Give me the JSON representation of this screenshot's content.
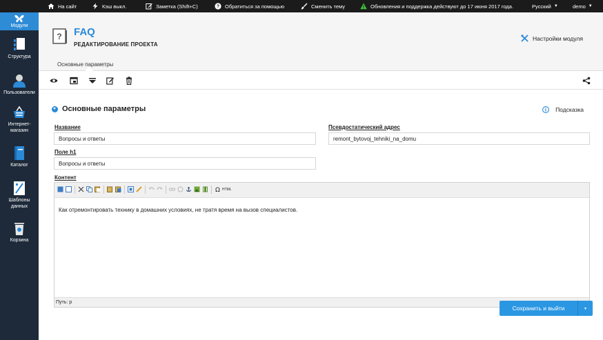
{
  "topbar": {
    "site": "На сайт",
    "cache": "Кэш выкл.",
    "note": "Заметка (Shift+C)",
    "help": "Обратиться за помощью",
    "theme": "Сменить тему",
    "updates": "Обновления и поддержка действуют до 17 июня 2017 года.",
    "language": "Русский",
    "user": "demo"
  },
  "sidebar": {
    "items": [
      {
        "label": "Модули"
      },
      {
        "label": "Структура"
      },
      {
        "label": "Пользователи"
      },
      {
        "label": "Интернет-\nмагазин"
      },
      {
        "label": "Каталог"
      },
      {
        "label": "Шаблоны\nданных"
      },
      {
        "label": "Корзина"
      }
    ]
  },
  "header": {
    "title": "FAQ",
    "subtitle": "РЕДАКТИРОВАНИЕ ПРОЕКТА",
    "module_settings": "Настройки модуля"
  },
  "tabs": {
    "main": "Основные параметры"
  },
  "section": {
    "title": "Основные параметры",
    "hint": "Подсказка"
  },
  "fields": {
    "name_label": "Название",
    "name_value": "Вопросы и ответы",
    "h1_label": "Поле h1",
    "h1_value": "Вопросы и ответы",
    "alias_label": "Псевдостатический адрес",
    "alias_value": "remont_bytovoj_tehniki_na_domu",
    "content_label": "Контент",
    "content_text": "Как отремонтировать технику в домашних условиях, не тратя время на вызов специалистов.",
    "editor_path": "Путь: p",
    "html_label": "HTML"
  },
  "actions": {
    "save": "Сохранить и выйти",
    "split_caret": "▾"
  },
  "colors": {
    "accent": "#2b8ad8",
    "sidebar": "#1e2a3a",
    "topbar": "#1b1b1b",
    "save": "#2b97e3"
  }
}
